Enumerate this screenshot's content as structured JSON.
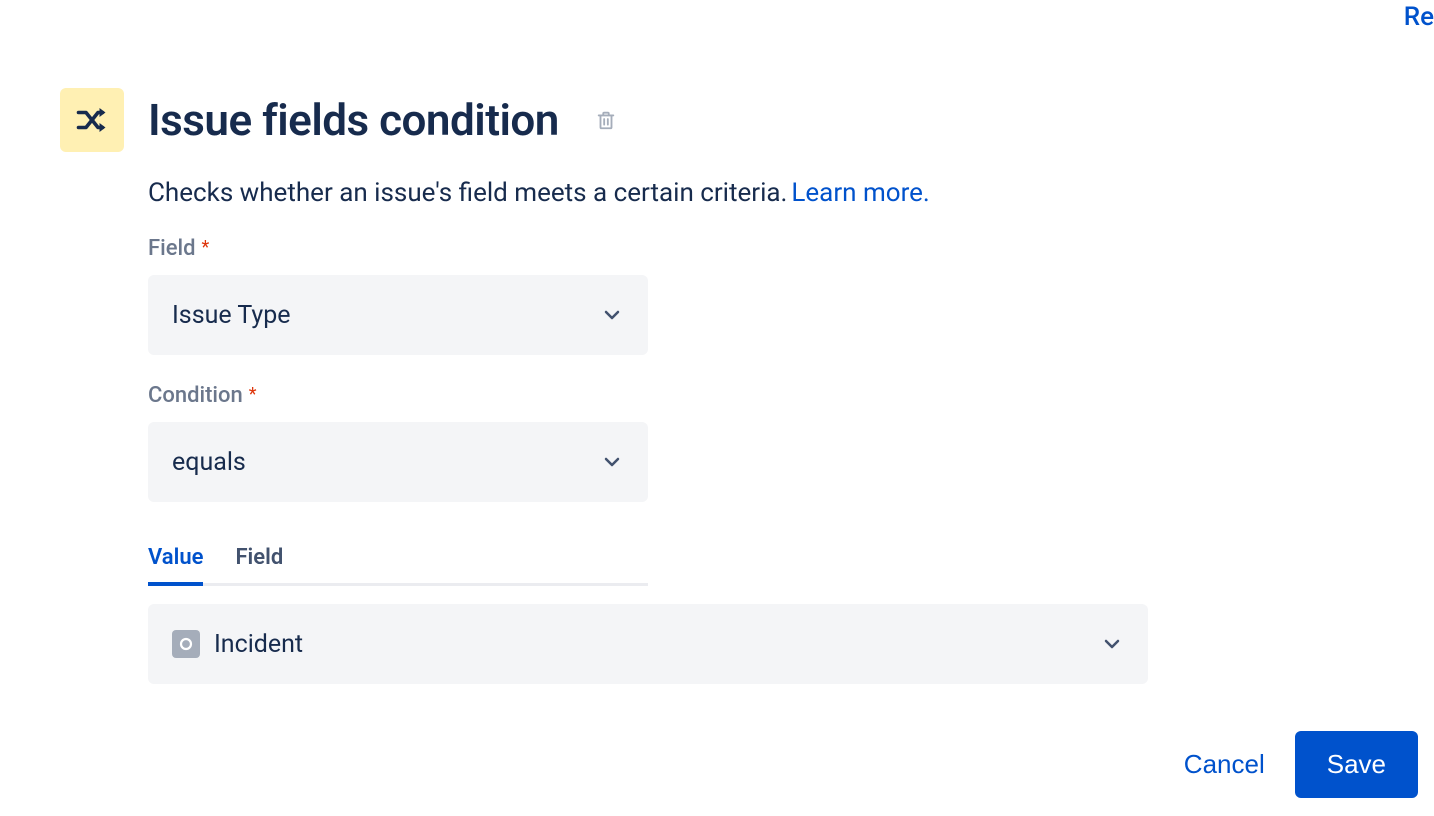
{
  "corner_link": "Re",
  "header": {
    "title": "Issue fields condition"
  },
  "description": "Checks whether an issue's field meets a certain criteria.",
  "learn_more": "Learn more.",
  "form": {
    "field_label": "Field",
    "field_value": "Issue Type",
    "condition_label": "Condition",
    "condition_value": "equals"
  },
  "tabs": {
    "value": "Value",
    "field": "Field"
  },
  "value_select": {
    "value": "Incident"
  },
  "footer": {
    "cancel": "Cancel",
    "save": "Save"
  }
}
